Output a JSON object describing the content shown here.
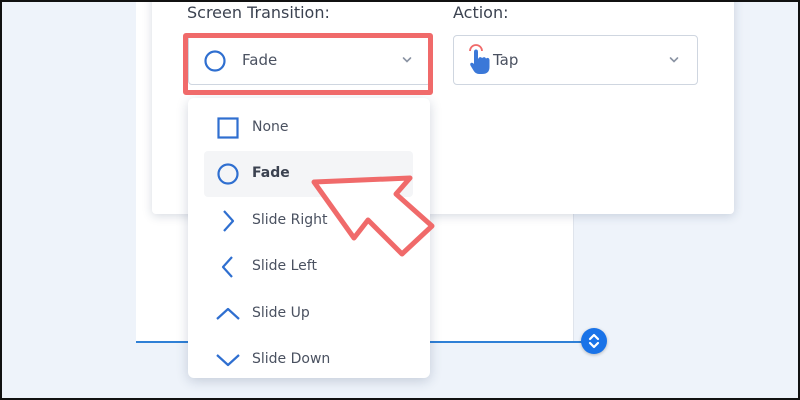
{
  "screen_transition": {
    "label": "Screen Transition:",
    "selected_value": "Fade",
    "selected_icon": "circle-icon"
  },
  "action": {
    "label": "Action:",
    "selected_value": "Tap",
    "selected_icon": "tap-hand-icon"
  },
  "dropdown": {
    "options": [
      {
        "label": "None",
        "icon": "square-icon"
      },
      {
        "label": "Fade",
        "icon": "circle-icon",
        "selected": true
      },
      {
        "label": "Slide Right",
        "icon": "chevron-right-icon"
      },
      {
        "label": "Slide Left",
        "icon": "chevron-left-icon"
      },
      {
        "label": "Slide Up",
        "icon": "chevron-up-icon"
      },
      {
        "label": "Slide Down",
        "icon": "chevron-down-icon"
      }
    ]
  },
  "colors": {
    "accent": "#2f6fd0",
    "highlight": "#f06a6a",
    "handle": "#1a73e8",
    "background": "#eef3fa"
  }
}
